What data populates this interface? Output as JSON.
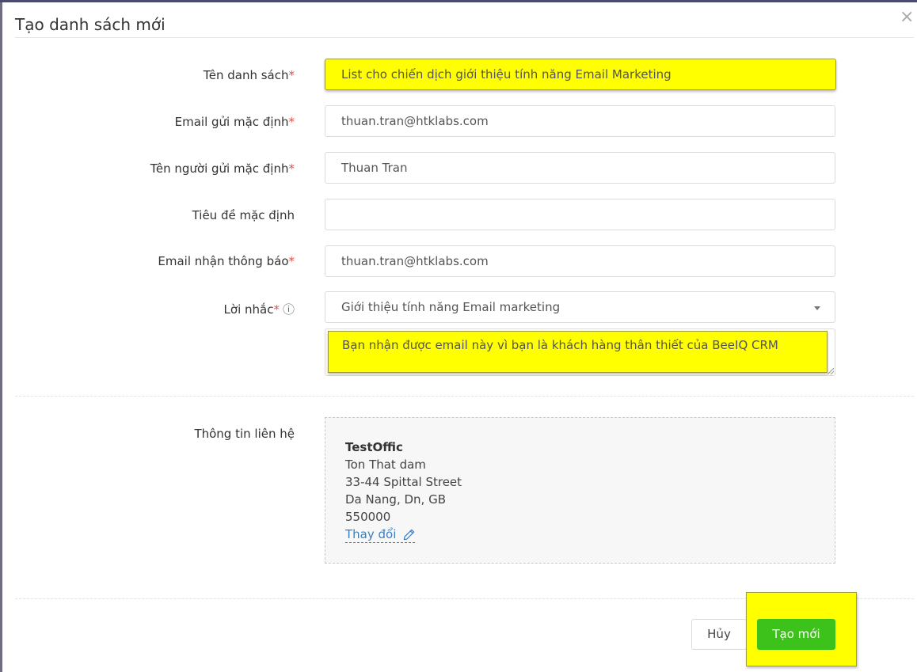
{
  "modal": {
    "title": "Tạo danh sách mới",
    "close_symbol": "×"
  },
  "form": {
    "list_name": {
      "label": "Tên danh sách",
      "required": "*",
      "value": "List cho chiến dịch giới thiệu tính năng Email Marketing"
    },
    "default_email": {
      "label": "Email gửi mặc định",
      "required": "*",
      "value": "thuan.tran@htklabs.com"
    },
    "default_sender_name": {
      "label": "Tên người gửi mặc định",
      "required": "*",
      "value": "Thuan Tran"
    },
    "default_subject": {
      "label": "Tiêu đề mặc định",
      "value": ""
    },
    "notify_email": {
      "label": "Email nhận thông báo",
      "required": "*",
      "value": "thuan.tran@htklabs.com"
    },
    "reminder": {
      "label": "Lời nhắc",
      "required": "*",
      "info_icon": "info-circle-icon",
      "info_symbol": "ⓘ",
      "selected": "Giới thiệu tính năng Email marketing",
      "text": "Bạn nhận được email này vì bạn là khách hàng thân thiết của BeeIQ CRM"
    },
    "contact": {
      "label": "Thông tin liên hệ",
      "company": "TestOffic",
      "address1": "Ton That dam",
      "address2": "33-44 Spittal Street",
      "city_line": "Da Nang, Dn, GB",
      "postal": "550000",
      "change_label": "Thay đổi",
      "change_icon": "pencil-icon"
    }
  },
  "actions": {
    "cancel_label": "Hủy",
    "create_label": "Tạo mới"
  },
  "colors": {
    "highlight": "#ffff00",
    "required": "#d9534f",
    "primary_button": "#3cc21a",
    "link": "#3a7fc1"
  }
}
